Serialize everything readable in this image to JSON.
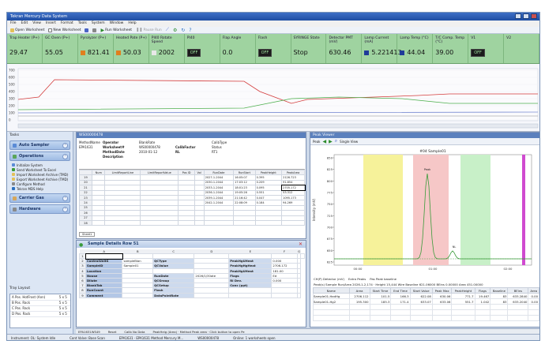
{
  "window": {
    "title": "Tekran Mercury Data System"
  },
  "menu": [
    "File",
    "Edit",
    "View",
    "Insert",
    "Format",
    "Tools",
    "System",
    "Window",
    "Help"
  ],
  "toolbar": {
    "open_worksheet": "Open Worksheet",
    "new_worksheet": "New Worksheet",
    "run_worksheet": "Run Worksheet",
    "pause_run": "Pause Run"
  },
  "status_cells": [
    {
      "label": "Trap Heater (P+)",
      "value": "29.47",
      "indicator": ""
    },
    {
      "label": "GC Oven (P+)",
      "value": "55.05",
      "indicator": ""
    },
    {
      "label": "Pyrolyzer (P+)",
      "value": "821.41",
      "indicator": "#e07f1e"
    },
    {
      "label": "Heated Pate (P+)",
      "value": "50.03",
      "indicator": "#e07f1e"
    },
    {
      "label": "PI40 Rotate Speed",
      "value": "2002",
      "indicator": "#e8e8e8"
    },
    {
      "label": "PI40",
      "value": "",
      "indicator": "",
      "button": "OFF"
    },
    {
      "label": "Flap Angle",
      "value": "0.0",
      "indicator": ""
    },
    {
      "label": "Flash",
      "value": "",
      "indicator": "",
      "button": "OFF"
    },
    {
      "label": "SYRINGE State",
      "value": "Stop",
      "indicator": ""
    },
    {
      "label": "Detector PMT (mV)",
      "value": "630.46",
      "indicator": ""
    },
    {
      "label": "Lamp Current (mA)",
      "value": "5.221413",
      "indicator": "#1f3b99"
    },
    {
      "label": "Lamp Temp (°C)",
      "value": "44.04",
      "indicator": "#1f3b99"
    },
    {
      "label": "T/C Comp. Temp (°C)",
      "value": "39.00",
      "indicator": ""
    },
    {
      "label": "V1",
      "value": "",
      "indicator": "",
      "button": "OFF"
    },
    {
      "label": "V2",
      "value": "",
      "indicator": ""
    }
  ],
  "timeline": {
    "y_ticks": [
      "700",
      "600",
      "500",
      "400",
      "300",
      "200",
      "100",
      "0"
    ],
    "series_colors": [
      "#d33b3b",
      "#4fb04f",
      "#4a63c5",
      "#8a8a8a"
    ]
  },
  "tasks": {
    "header": "Tasks",
    "groups": [
      {
        "label": "Auto Sampler",
        "items": []
      },
      {
        "label": "Operations",
        "items": [
          "Initialize System",
          "Send Worksheet To Excel",
          "Import Worksheet Archive (TMD)",
          "Export Worksheet Archive (TMD)",
          "Configure Method",
          "Tekran MDS Help"
        ]
      },
      {
        "label": "Carrier Gas",
        "items": []
      },
      {
        "label": "Hardware",
        "items": []
      }
    ]
  },
  "tracker": {
    "header": "Tray Layout",
    "rows": [
      {
        "name": "A Pos. HotFrost (Ann)",
        "pos": "5 x 5"
      },
      {
        "name": "B Pos. Rack",
        "pos": "5 x 5"
      },
      {
        "name": "C Pos. Rack",
        "pos": "5 x 5"
      },
      {
        "name": "D Pos. Rack",
        "pos": "5 x 5"
      }
    ]
  },
  "worksheet": {
    "title": "WS00000478",
    "header_rows": [
      {
        "k1": "MethodName",
        "v1": "Operator",
        "k2": "BlankRate",
        "v2": "",
        "k3": "CalibType",
        "v3": ""
      },
      {
        "k1": "EPA1631",
        "v1": "Worksheet#",
        "k2": "WS00000478",
        "v2": "CalibFactor",
        "k3": "Status",
        "v3": ""
      },
      {
        "k1": "",
        "v1": "MethodDate",
        "k2": "2010-01-12",
        "v2": "RL",
        "k3": "RT1",
        "v3": ""
      },
      {
        "k1": "",
        "v1": "Description",
        "k2": "",
        "v2": "",
        "k3": "",
        "v3": ""
      }
    ],
    "columns": [
      "",
      "Num",
      "LimitReportLine",
      "LimitReportValue",
      "Pos ID",
      "Vol",
      "RunDate",
      "RunStart",
      "PeakHeight",
      "PeakArea"
    ],
    "rows": [
      {
        "num": "19",
        "date": "2027-1-2044",
        "start": "16:05:07",
        "h": "0.395",
        "a": "2126.723"
      },
      {
        "num": "20",
        "date": "2030-1-2044",
        "start": "17:03:12",
        "h": "0.209",
        "a": "91.854"
      },
      {
        "num": "21",
        "date": "2033-1-2044",
        "start": "18:01:23",
        "h": "0.095",
        "a": "2705.172"
      },
      {
        "num": "22",
        "date": "2036-1-2044",
        "start": "19:05:26",
        "h": "0.551",
        "a": "53.312"
      },
      {
        "num": "23",
        "date": "2039-1-2044",
        "start": "21:16:42",
        "h": "0.047",
        "a": "1095.173"
      },
      {
        "num": "24",
        "date": "2042-1-2044",
        "start": "22:08:09",
        "h": "0.184",
        "a": "94.269"
      },
      {
        "num": "25",
        "date": "",
        "start": "",
        "h": "",
        "a": ""
      },
      {
        "num": "26",
        "date": "",
        "start": "",
        "h": "",
        "a": ""
      },
      {
        "num": "27",
        "date": "",
        "start": "",
        "h": "",
        "a": ""
      },
      {
        "num": "28",
        "date": "",
        "start": "",
        "h": "",
        "a": ""
      }
    ],
    "sheet_tab": "Sheet1"
  },
  "sample_details": {
    "title": "Sample Details Row 51",
    "columns": [
      "",
      "A",
      "B",
      "C",
      "D",
      "E",
      "F",
      "G"
    ],
    "rows": [
      [
        "",
        "",
        "",
        "",
        "",
        "",
        "",
        ""
      ],
      [
        "ControlUnitS",
        "sampleBlan",
        "QCType",
        "",
        "PeakHgUHeat",
        "0.000",
        ""
      ],
      [
        "SampleID",
        "Sample01",
        "QCValue",
        "",
        "PeakHgHgHeat",
        "2706.172",
        ""
      ],
      [
        "Location",
        "",
        "",
        "",
        "PeakHgUHeat",
        "181.00",
        ""
      ],
      [
        "Nouse",
        "",
        "RunDate",
        "2026/1/30ate",
        "Flags",
        "Ed",
        ""
      ],
      [
        "Dilute",
        "",
        "QCGroup",
        "",
        "RI Dev.",
        "0.000",
        ""
      ],
      [
        "BlankTab",
        "",
        "QCSetup",
        "",
        "Conc (ppt)",
        "",
        ""
      ],
      [
        "RunCount",
        "",
        "Flash",
        "",
        "",
        "",
        ""
      ],
      [
        "Comment",
        "",
        "DataPointRate",
        "",
        "",
        "",
        ""
      ]
    ],
    "sheet_tab": "Sheet1"
  },
  "peak_viewer": {
    "title": "Peak Viewer",
    "tools": [
      "Peak",
      "Single View"
    ],
    "chart_title": "#04 Sample01",
    "y_label": "Intensity (mV)",
    "y_ticks": [
      "850",
      "825",
      "800",
      "775",
      "750",
      "725",
      "700",
      "675",
      "650",
      "625"
    ],
    "x_ticks": [
      "00:00",
      "01:00",
      "02:00"
    ],
    "annotations": [
      "Peak",
      "NL"
    ],
    "legend": [
      "CH(P) Detector (mV)",
      "Extra Peaks",
      "Pas Peak baseline"
    ],
    "table_caption": "Peak(s) Sample Run/Area 2026-1-2,174 · Height 15,444 Wire Baseline 621.06000 BEins 0.00000 Area 451.00000",
    "table_columns": [
      "Name",
      "Area",
      "Start Time",
      "End Time",
      "Start Value",
      "Peak Max",
      "PeakHeight",
      "Flags",
      "Baseline",
      "BEins",
      "Area"
    ],
    "table_rows": [
      [
        "Sample01-HadHg",
        "2706.112",
        "101.5",
        "166.3",
        "622.08",
        "630.06",
        "771.7",
        "19.467",
        "83",
        "633.2840",
        "0.00"
      ],
      [
        "Sample01-Hg2",
        "195.300",
        "185.3",
        "171.4",
        "633.07",
        "633.06",
        "551.7",
        "1.042",
        "83",
        "633.2040",
        "0.00"
      ]
    ]
  },
  "statusbar": [
    "EPA1631WS49",
    "Reset",
    "",
    "Calib No Data",
    "PeakHeig (Area) · Method Peak area · Click button to open Pe",
    ""
  ],
  "footer": [
    "Instrument: OL: System Idle",
    "Cont Valve: Base Scan",
    "EPA1631 · EPA1631 Method Mercury M...",
    "WS00000478",
    "Online: 1 worksheets open"
  ]
}
